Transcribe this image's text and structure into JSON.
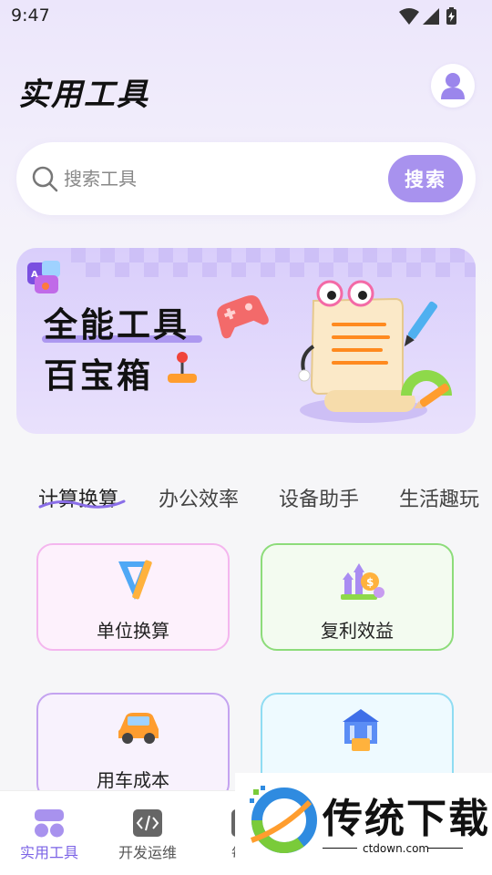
{
  "status_bar": {
    "time": "9:47",
    "icons": [
      "wifi-icon",
      "signal-icon",
      "battery-charging-icon"
    ]
  },
  "header": {
    "title": "实用工具",
    "avatar_icon": "user-icon"
  },
  "search": {
    "placeholder": "搜索工具",
    "value": "",
    "button_label": "搜索",
    "icon": "search-icon"
  },
  "banner": {
    "line1": "全能工具",
    "line2": "百宝箱"
  },
  "tabs": [
    {
      "label": "计算换算",
      "active": true
    },
    {
      "label": "办公效率",
      "active": false
    },
    {
      "label": "设备助手",
      "active": false
    },
    {
      "label": "生活趣玩",
      "active": false
    }
  ],
  "tools": [
    {
      "label": "单位换算",
      "icon": "ruler-triangle-icon",
      "border": "#f4b6ee",
      "bg": "#fdf1fc"
    },
    {
      "label": "复利效益",
      "icon": "coin-growth-icon",
      "border": "#8ddc7a",
      "bg": "#f3fbf0"
    },
    {
      "label": "用车成本",
      "icon": "car-icon",
      "border": "#c4a3f0",
      "bg": "#f8f2fd"
    },
    {
      "label": "",
      "icon": "bank-icon",
      "border": "#8fdcf2",
      "bg": "#eefaff"
    }
  ],
  "bottom_nav": [
    {
      "label": "实用工具",
      "icon": "apps-icon",
      "active": true
    },
    {
      "label": "开发运维",
      "icon": "code-icon",
      "active": false
    },
    {
      "label": "每日",
      "icon": "calendar-icon",
      "active": false
    }
  ],
  "watermark": {
    "text": "传统下载",
    "url": "ctdown.com"
  },
  "colors": {
    "accent": "#a892ee",
    "active_nav": "#7b63e6"
  }
}
